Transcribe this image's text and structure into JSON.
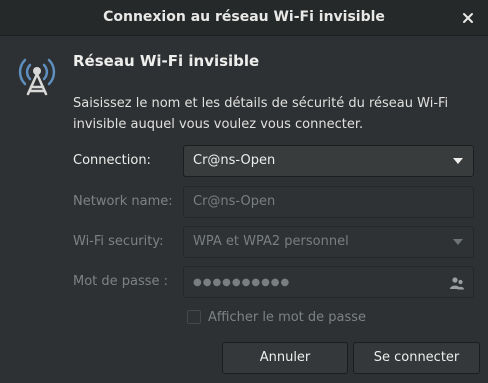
{
  "window": {
    "title": "Connexion au réseau Wi-Fi invisible",
    "close_glyph": "✕"
  },
  "dialog": {
    "icon": "wifi-tower-icon",
    "heading": "Réseau Wi-Fi invisible",
    "description": "Saisissez le nom et les détails de sécurité du réseau Wi-Fi invisible auquel vous voulez vous connecter."
  },
  "form": {
    "connection": {
      "label": "Connection:",
      "value": "Cr@ns-Open"
    },
    "network_name": {
      "label": "Network name:",
      "value": "Cr@ns-Open"
    },
    "security": {
      "label": "Wi-Fi security:",
      "value": "WPA et WPA2 personnel"
    },
    "password": {
      "label": "Mot de passe :",
      "value": "●●●●●●●●●●",
      "icon": "users-icon"
    },
    "show_password": {
      "label": "Afficher le mot de passe",
      "checked": false
    }
  },
  "buttons": {
    "cancel": "Annuler",
    "connect": "Se connecter"
  },
  "colors": {
    "background": "#2e3133",
    "titlebar": "#26292a",
    "text": "#eeeeec",
    "dim_text": "#7d8284"
  }
}
